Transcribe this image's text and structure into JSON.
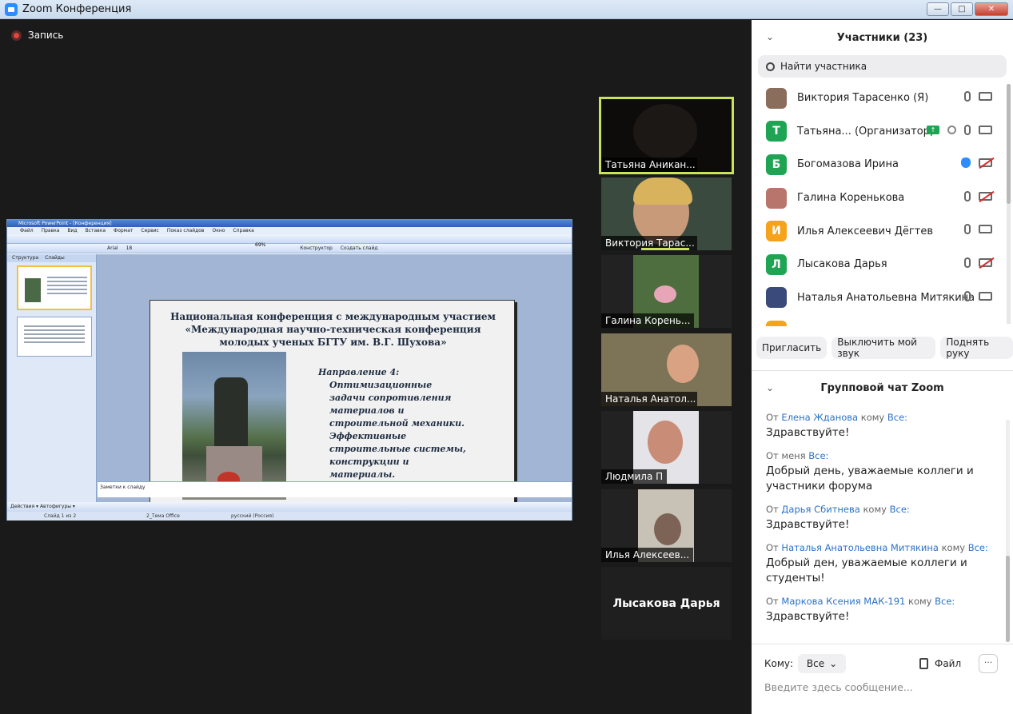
{
  "window": {
    "title": "Zoom Конференция",
    "minimize": "—",
    "maximize": "□",
    "close": "✕"
  },
  "recording": {
    "label": "Запись"
  },
  "ppt": {
    "title": "Microsoft PowerPoint - [Конференция]",
    "menu": [
      "Файл",
      "Правка",
      "Вид",
      "Вставка",
      "Формат",
      "Сервис",
      "Показ слайдов",
      "Окно",
      "Справка"
    ],
    "font": "Arial",
    "font_size": "18",
    "zoom": "69%",
    "constructor": "Конструктор",
    "new_slide": "Создать слайд",
    "tabs": [
      "Структура",
      "Слайды"
    ],
    "slide_title": "Национальная конференция с международным участием «Международная научно-техническая конференция молодых ученых БГТУ им. В.Г. Шухова»",
    "direction_label": "Направление 4:",
    "direction_text": "Оптимизационные задачи сопротивления материалов и строительной механики. Эффективные строительные системы, конструкции и материалы.",
    "notes": "Заметки к слайду",
    "draw": "Действия ▾   Автофигуры ▾",
    "status": {
      "slide": "Слайд 1 из 2",
      "theme": "2_Тема Office",
      "lang": "русский (Россия)"
    }
  },
  "videos": [
    {
      "name": "Татьяна Аникан..."
    },
    {
      "name": "Виктория Тарас..."
    },
    {
      "name": "Галина Корень..."
    },
    {
      "name": "Наталья Анатол..."
    },
    {
      "name": "Людмила П"
    },
    {
      "name": "Илья Алексеев..."
    },
    {
      "name": "Лысакова Дарья"
    }
  ],
  "participants": {
    "title": "Участники (23)",
    "search_placeholder": "Найти участника",
    "list": [
      {
        "name": "Виктория Тарасенко (Я)",
        "avatar": "",
        "color": "#8a6d5a"
      },
      {
        "name": "Татьяна...  (Организатор)",
        "avatar": "Т",
        "color": "#1fa454"
      },
      {
        "name": "Богомазова Ирина",
        "avatar": "Б",
        "color": "#1fa454"
      },
      {
        "name": "Галина Коренькова",
        "avatar": "",
        "color": "#b7756c"
      },
      {
        "name": "Илья Алексеевич Дёгтев",
        "avatar": "И",
        "color": "#f7a21b"
      },
      {
        "name": "Лысакова Дарья",
        "avatar": "Л",
        "color": "#1fa454"
      },
      {
        "name": "Наталья Анатольевна Митякина",
        "avatar": "",
        "color": "#3a4a7a"
      }
    ],
    "buttons": [
      "Пригласить",
      "Выключить мой звук",
      "Поднять руку"
    ]
  },
  "chat": {
    "title": "Групповой чат Zoom",
    "messages": [
      {
        "from_prefix": "От",
        "from": "Елена Жданова",
        "to_prefix": "кому",
        "to": "Все:",
        "text": "Здравствуйте!"
      },
      {
        "from_prefix": "От",
        "from": "меня",
        "to_prefix": "",
        "to": "Все:",
        "text": "Добрый день, уважаемые коллеги и участники форума"
      },
      {
        "from_prefix": "От",
        "from": "Дарья Сбитнева",
        "to_prefix": "кому",
        "to": "Все:",
        "text": "Здравствуйте!"
      },
      {
        "from_prefix": "От",
        "from": "Наталья Анатольевна Митякина",
        "to_prefix": "кому",
        "to": "Все:",
        "text": "Добрый ден, уважаемые коллеги и студенты!"
      },
      {
        "from_prefix": "От",
        "from": "Маркова Ксения МАК-191",
        "to_prefix": "кому",
        "to": "Все:",
        "text": "Здравствуйте!"
      }
    ],
    "to_label": "Кому:",
    "to_value": "Все",
    "file_label": "Файл",
    "more": "···",
    "input_placeholder": "Введите здесь сообщение..."
  }
}
